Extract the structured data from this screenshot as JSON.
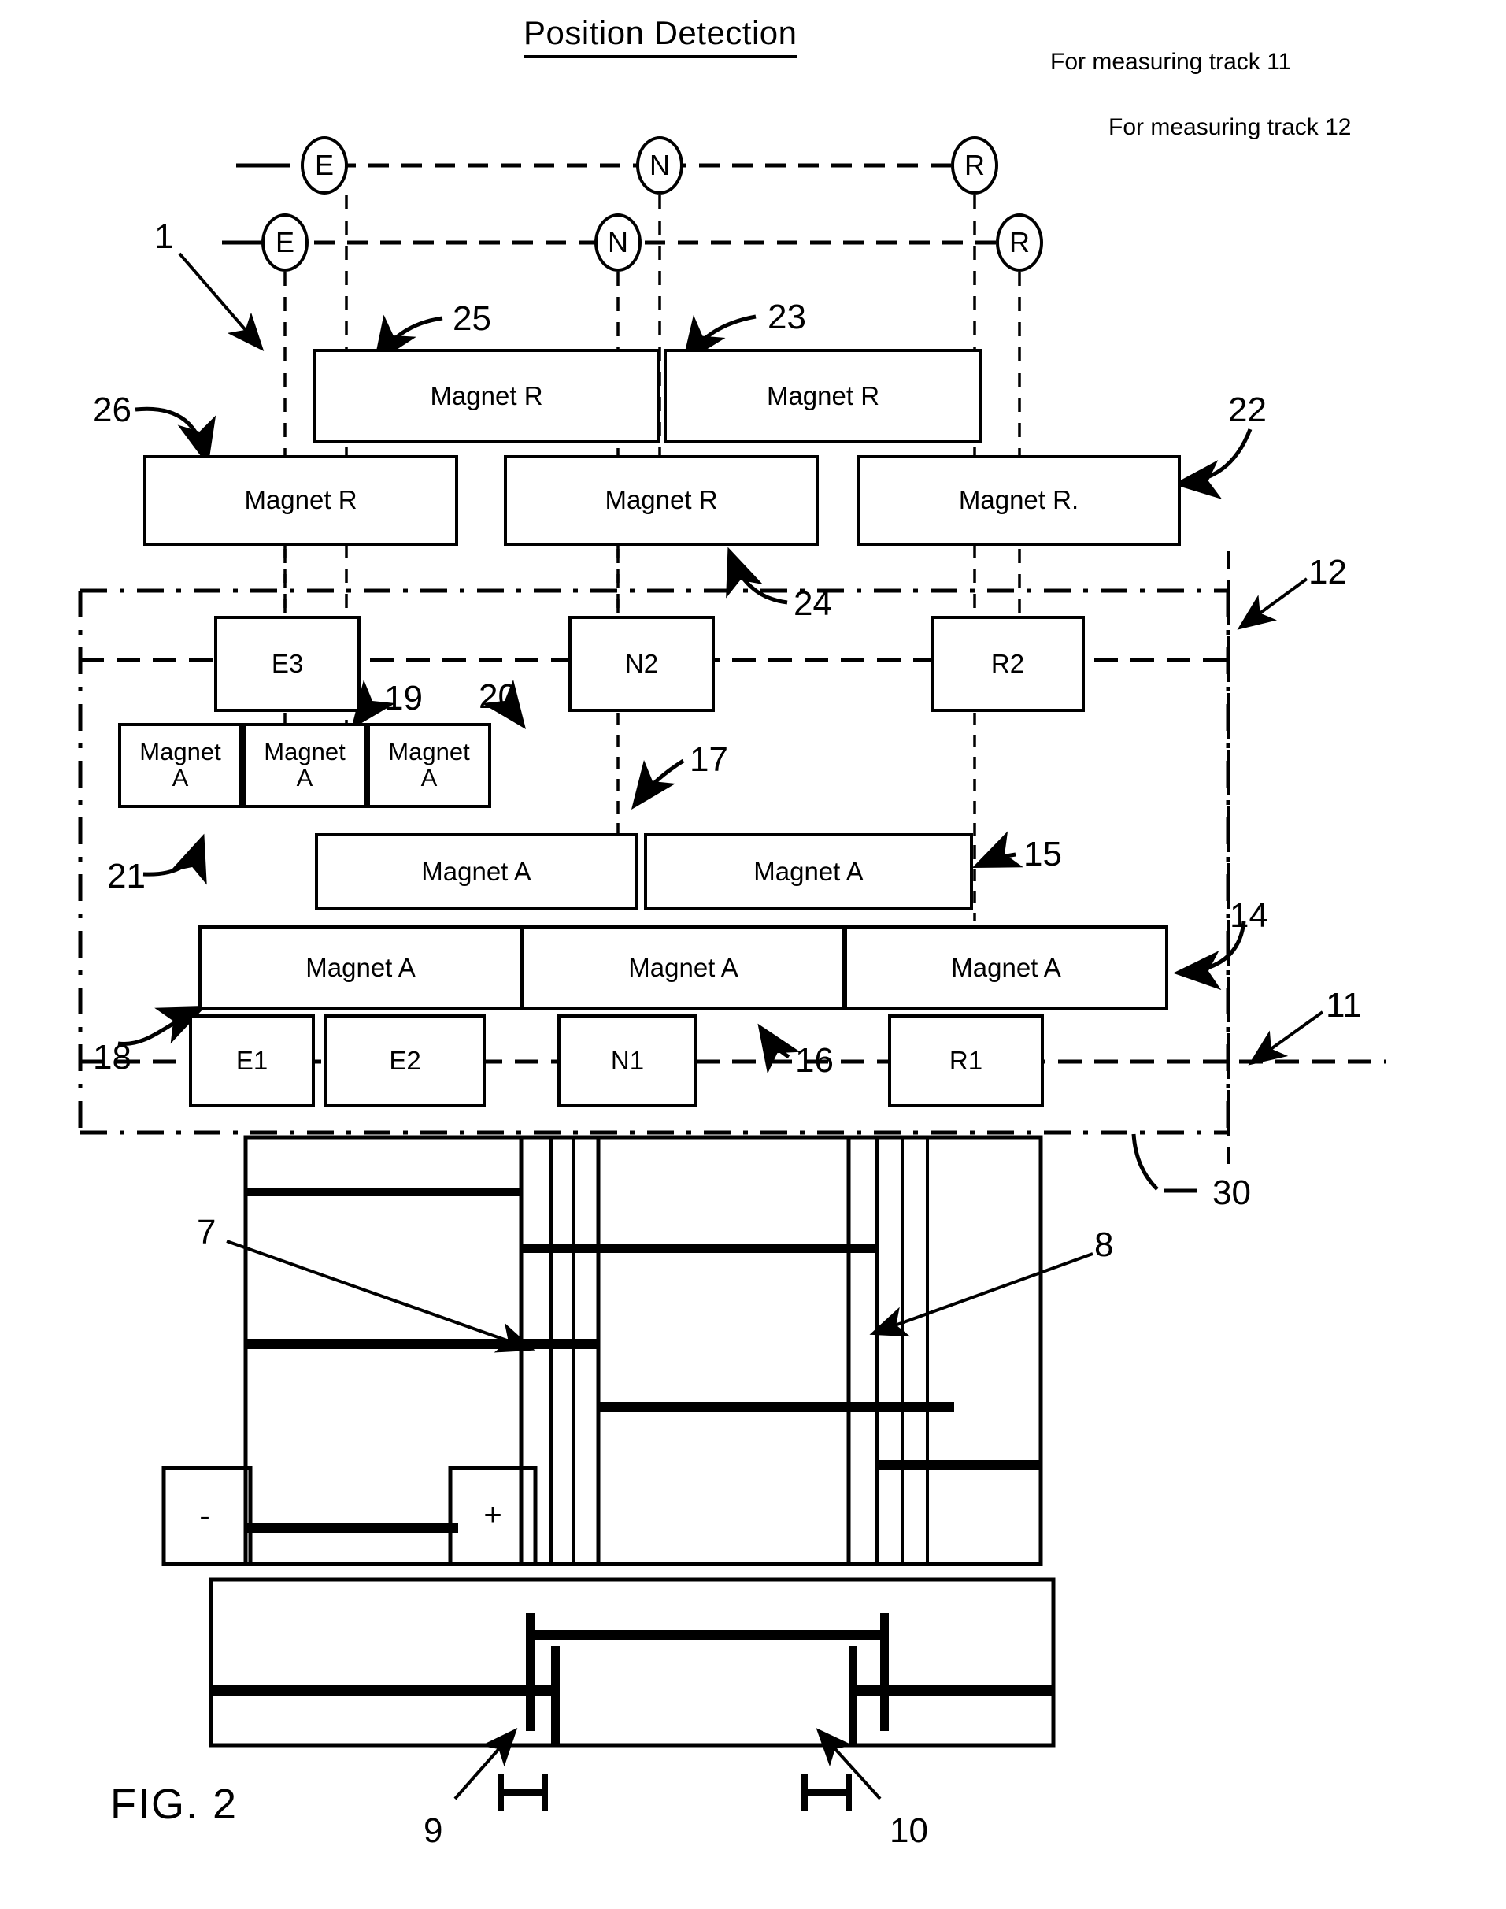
{
  "figure": {
    "title": "Position Detection",
    "figure_label": "FIG. 2"
  },
  "annotations": {
    "track_note_1": "For measuring track 11",
    "track_note_2": "For measuring track 12"
  },
  "nodes": {
    "top_row": [
      {
        "label": "E"
      },
      {
        "label": "N"
      },
      {
        "label": "R"
      }
    ],
    "second_row": [
      {
        "label": "E"
      },
      {
        "label": "N"
      },
      {
        "label": "R"
      }
    ]
  },
  "magnet_r_upper": [
    {
      "label": "Magnet R"
    },
    {
      "label": "Magnet R"
    }
  ],
  "magnet_r_lower": [
    {
      "label": "Magnet R"
    },
    {
      "label": "Magnet R"
    },
    {
      "label": "Magnet R."
    }
  ],
  "sensors_upper": [
    {
      "label": "E3"
    },
    {
      "label": "N2"
    },
    {
      "label": "R2"
    }
  ],
  "magnet_a_small": [
    {
      "line1": "Magnet",
      "line2": "A"
    },
    {
      "line1": "Magnet",
      "line2": "A"
    },
    {
      "line1": "Magnet",
      "line2": "A"
    }
  ],
  "magnet_a_middle": [
    {
      "label": "Magnet A"
    },
    {
      "label": "Magnet A"
    }
  ],
  "magnet_a_lower": [
    {
      "label": "Magnet A"
    },
    {
      "label": "Magnet A"
    },
    {
      "label": "Magnet A"
    }
  ],
  "sensors_lower": [
    {
      "label": "E1"
    },
    {
      "label": "E2"
    },
    {
      "label": "N1"
    },
    {
      "label": "R1"
    }
  ],
  "polarity": {
    "minus": "-",
    "plus": "+"
  },
  "reference_numerals": {
    "n1": "1",
    "n7": "7",
    "n8": "8",
    "n9": "9",
    "n10": "10",
    "n11": "11",
    "n12": "12",
    "n14": "14",
    "n15": "15",
    "n16": "16",
    "n17": "17",
    "n18": "18",
    "n19": "19",
    "n20": "20",
    "n21": "21",
    "n22": "22",
    "n23": "23",
    "n24": "24",
    "n25": "25",
    "n26": "26",
    "n30": "30"
  }
}
